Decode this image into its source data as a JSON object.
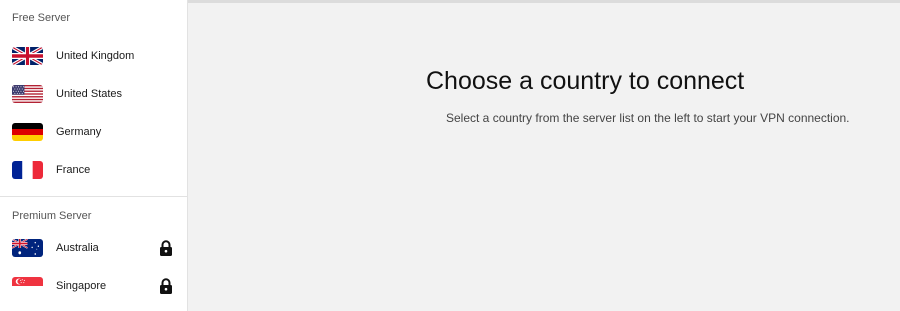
{
  "sidebar": {
    "free": {
      "title": "Free Server",
      "items": [
        {
          "label": "United Kingdom",
          "flag": "uk-flag",
          "locked": false
        },
        {
          "label": "United States",
          "flag": "us-flag",
          "locked": false
        },
        {
          "label": "Germany",
          "flag": "germany-flag",
          "locked": false
        },
        {
          "label": "France",
          "flag": "france-flag",
          "locked": false
        }
      ]
    },
    "premium": {
      "title": "Premium Server",
      "items": [
        {
          "label": "Australia",
          "flag": "australia-flag",
          "locked": true
        },
        {
          "label": "Singapore",
          "flag": "singapore-flag",
          "locked": true
        }
      ]
    }
  },
  "main": {
    "title": "Choose a country to connect",
    "subtitle": "Select a country from the server list on the left to start your VPN connection."
  },
  "colors": {
    "sidebar_bg": "#ffffff",
    "main_bg": "#f2f2f2",
    "text": "#1a1a1a"
  }
}
